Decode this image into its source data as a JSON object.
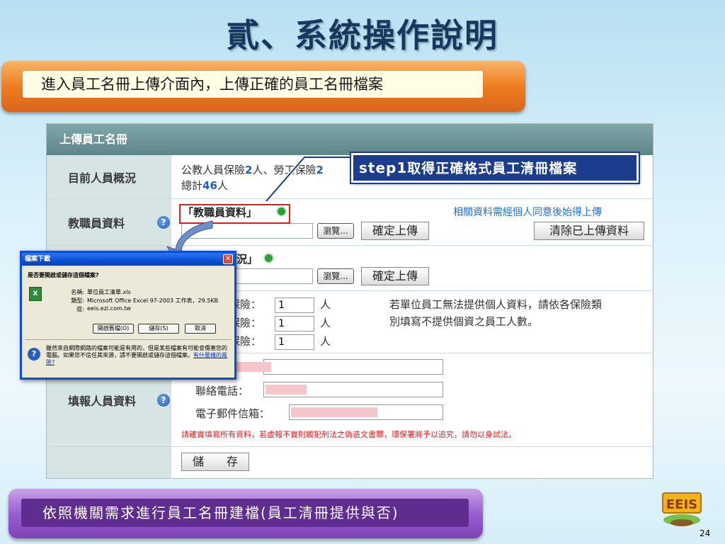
{
  "slide": {
    "title": "貳、系統操作說明",
    "top_banner": "進入員工名冊上傳介面內，上傳正確的員工名冊檔案",
    "bottom_banner": "依照機關需求進行員工名冊建檔(員工清冊提供與否)",
    "page_number": "24",
    "logo_text": "EEIS"
  },
  "callout": {
    "step": "step1",
    "text": "取得正確格式員工清冊檔案"
  },
  "panel": {
    "title": "上傳員工名冊",
    "summary": {
      "label": "目前人員概況",
      "line1_pre": "公教人員保險",
      "line1_num1": "2",
      "line1_mid": "人、勞工保險",
      "line1_num2": "2",
      "line2_pre": "總計",
      "line2_num": "46",
      "line2_post": "人"
    },
    "staff": {
      "label": "教職員資料",
      "file_label": "「教職員資料」",
      "consent_note": "相關資料需經個人同意後始得上傳",
      "browse": "瀏覽...",
      "confirm_upload": "確定上傳",
      "clear_uploaded": "清除已上傳資料"
    },
    "status": {
      "file_label_partial": "況」",
      "browse": "瀏覽...",
      "confirm_upload": "確定上傳"
    },
    "insurance": {
      "rows": [
        {
          "label_partial": "保險：",
          "value": "1",
          "unit": "人"
        },
        {
          "label_partial": "保險：",
          "value": "1",
          "unit": "人"
        },
        {
          "label_partial": "保險：",
          "value": "1",
          "unit": "人"
        }
      ],
      "note_line1": "若單位員工無法提供個人資料，請依各保險類",
      "note_line2": "別填寫不提供個資之員工人數。"
    },
    "reporter": {
      "label": "填報人員資料",
      "phone_label": "聯絡電話：",
      "email_label": "電子郵件信箱：",
      "warning": "請確實填寫所有資料，若虛報不實則觸犯刑法之偽造文書罪，環保署將予以追究，請勿以身試法。"
    },
    "save": "儲　　存"
  },
  "dialog": {
    "title": "檔案下載",
    "question": "是否要開啟或儲存這個檔案?",
    "name_label": "名稱:",
    "name_value": "單位員工清單.xls",
    "type_label": "類型:",
    "type_value": "Microsoft Office Excel 97-2003 工作表，29.5KB",
    "from_label": "從:",
    "from_value": "eeis.ezi.com.tw",
    "open_button": "開啟舊檔(O)",
    "save_button": "儲存(S)",
    "cancel_button": "取消",
    "warning_text": "雖然來自網際網路的檔案可能是有用的，但是某些檔案有可能會傷害您的電腦。如果您不信任其來源，請不要開啟或儲存這個檔案。",
    "risk_link": "有什麼樣的風險?"
  },
  "colors": {
    "title": "#17375e",
    "orange": "#ee7d21",
    "purple": "#7d44b6",
    "callout": "#1c3c8e",
    "panel_header": "#5e8587",
    "warning_red": "#e02020"
  }
}
